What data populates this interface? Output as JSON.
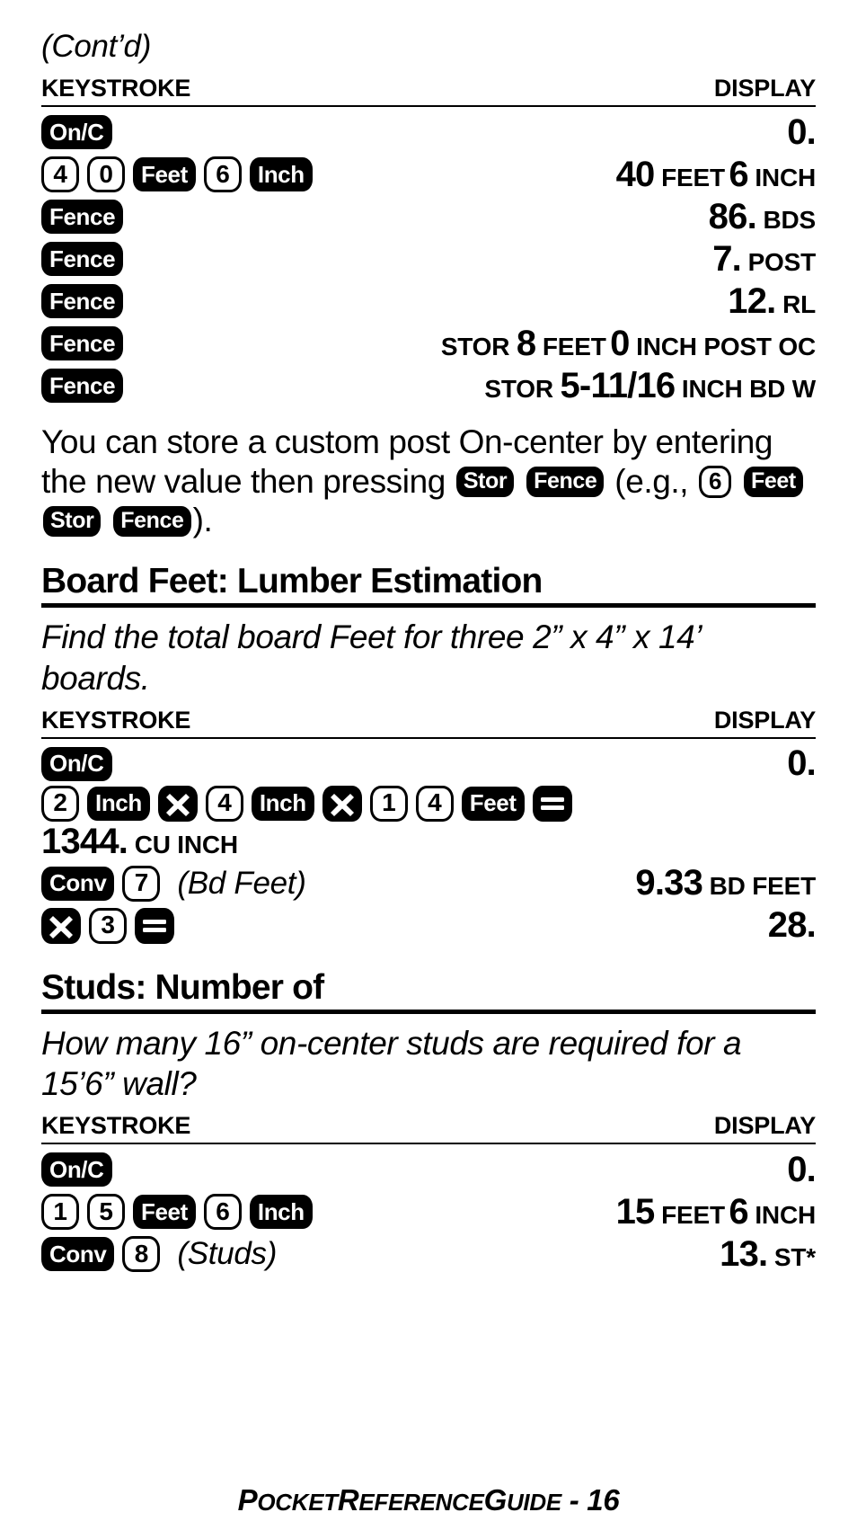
{
  "page": {
    "continued_label": "(Cont’d)",
    "footer": {
      "text_lead": "P",
      "text": "POCKET REFERENCE GUIDE - 16",
      "parts": [
        "P",
        "OCKET",
        "R",
        "EFERENCE",
        "G",
        "UIDE",
        " - 16"
      ]
    }
  },
  "table_headers": {
    "keystroke": "KEYSTROKE",
    "display": "DISPLAY"
  },
  "fence_section": {
    "rows": [
      {
        "keys": [
          {
            "type": "fn",
            "label": "On/C"
          }
        ],
        "display": {
          "value": "0.",
          "unit": ""
        }
      },
      {
        "keys": [
          {
            "type": "num",
            "label": "4"
          },
          {
            "type": "num",
            "label": "0"
          },
          {
            "type": "fn",
            "label": "Feet"
          },
          {
            "type": "num",
            "label": "6"
          },
          {
            "type": "fn",
            "label": "Inch"
          }
        ],
        "display": {
          "prefix": "",
          "segments": [
            {
              "value": "40",
              "unit": "FEET"
            },
            {
              "value": "6",
              "unit": "INCH"
            }
          ]
        }
      },
      {
        "keys": [
          {
            "type": "fn",
            "label": "Fence"
          }
        ],
        "display": {
          "prefix": "",
          "segments": [
            {
              "value": "86.",
              "unit": "BDS"
            }
          ]
        }
      },
      {
        "keys": [
          {
            "type": "fn",
            "label": "Fence"
          }
        ],
        "display": {
          "prefix": "",
          "segments": [
            {
              "value": "7.",
              "unit": "POST"
            }
          ]
        }
      },
      {
        "keys": [
          {
            "type": "fn",
            "label": "Fence"
          }
        ],
        "display": {
          "prefix": "",
          "segments": [
            {
              "value": "12.",
              "unit": "RL"
            }
          ]
        }
      },
      {
        "keys": [
          {
            "type": "fn",
            "label": "Fence"
          }
        ],
        "display": {
          "prefix": "STOR",
          "segments": [
            {
              "value": "8",
              "unit": "FEET"
            },
            {
              "value": "0",
              "unit": "INCH POST OC"
            }
          ]
        }
      },
      {
        "keys": [
          {
            "type": "fn",
            "label": "Fence"
          }
        ],
        "display": {
          "prefix": "STOR",
          "segments": [
            {
              "value": "5-11/16",
              "unit": "INCH BD W"
            }
          ]
        }
      }
    ],
    "paragraph": {
      "part1": "You can store a custom post On-center by entering the new value then pressing ",
      "key_stor": "Stor",
      "key_fence": "Fence",
      "part2": " (e.g., ",
      "key_6": "6",
      "key_feet": "Feet",
      "key_stor2": "Stor",
      "key_fence2": "Fence",
      "part3": ")."
    }
  },
  "board_feet_section": {
    "heading": "Board Feet: Lumber Estimation",
    "prompt": "Find the total board Feet for three 2” x 4” x 14’ boards.",
    "rows": [
      {
        "keys": [
          {
            "type": "fn",
            "label": "On/C"
          }
        ],
        "display": {
          "prefix": "",
          "segments": [
            {
              "value": "0.",
              "unit": ""
            }
          ]
        }
      },
      {
        "stacked": true,
        "keys": [
          {
            "type": "num",
            "label": "2"
          },
          {
            "type": "fn",
            "label": "Inch"
          },
          {
            "type": "op",
            "label": "×"
          },
          {
            "type": "num",
            "label": "4"
          },
          {
            "type": "fn",
            "label": "Inch"
          },
          {
            "type": "op",
            "label": "×"
          },
          {
            "type": "num",
            "label": "1"
          },
          {
            "type": "num",
            "label": "4"
          },
          {
            "type": "fn",
            "label": "Feet"
          },
          {
            "type": "op",
            "label": "="
          }
        ],
        "display": {
          "prefix": "",
          "segments": [
            {
              "value": "1344.",
              "unit": "CU INCH"
            }
          ]
        }
      },
      {
        "keys": [
          {
            "type": "fn",
            "label": "Conv"
          },
          {
            "type": "num",
            "label": "7"
          }
        ],
        "annotation": "(Bd Feet)",
        "display": {
          "prefix": "",
          "segments": [
            {
              "value": "9.33",
              "unit": "BD FEET"
            }
          ]
        }
      },
      {
        "keys": [
          {
            "type": "op",
            "label": "×"
          },
          {
            "type": "num",
            "label": "3"
          },
          {
            "type": "op",
            "label": "="
          }
        ],
        "display": {
          "prefix": "",
          "segments": [
            {
              "value": "28.",
              "unit": ""
            }
          ]
        }
      }
    ]
  },
  "studs_section": {
    "heading": "Studs: Number of",
    "prompt": "How many 16” on-center studs are required for a 15’6” wall?",
    "rows": [
      {
        "keys": [
          {
            "type": "fn",
            "label": "On/C"
          }
        ],
        "display": {
          "prefix": "",
          "segments": [
            {
              "value": "0.",
              "unit": ""
            }
          ]
        }
      },
      {
        "keys": [
          {
            "type": "num",
            "label": "1"
          },
          {
            "type": "num",
            "label": "5"
          },
          {
            "type": "fn",
            "label": "Feet"
          },
          {
            "type": "num",
            "label": "6"
          },
          {
            "type": "fn",
            "label": "Inch"
          }
        ],
        "display": {
          "prefix": "",
          "segments": [
            {
              "value": "15",
              "unit": "FEET"
            },
            {
              "value": "6",
              "unit": "INCH"
            }
          ]
        }
      },
      {
        "keys": [
          {
            "type": "fn",
            "label": "Conv"
          },
          {
            "type": "num",
            "label": "8"
          }
        ],
        "annotation": "(Studs)",
        "display": {
          "prefix": "",
          "segments": [
            {
              "value": "13.",
              "unit": "ST*"
            }
          ]
        }
      }
    ]
  }
}
